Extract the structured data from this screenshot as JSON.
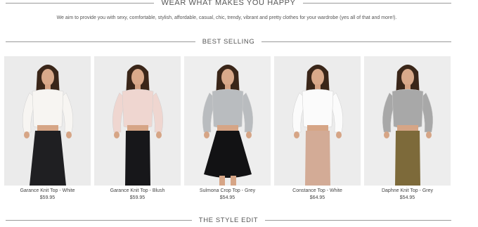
{
  "header": {
    "title": "WEAR WHAT MAKES YOU HAPPY",
    "tagline": "We aim to provide you with sexy, comfortable, stylish, affordable, casual, chic, trendy, vibrant and pretty clothes for your wardrobe (yes all of that and more!)."
  },
  "best_selling": {
    "title": "BEST SELLING",
    "products": [
      {
        "name": "Garance Knit Top - White",
        "price": "$59.95",
        "top_color": "#f7f5f2",
        "bottom_color": "#1f1f22",
        "bottom_style": "ruffle-skirt",
        "bg": "#ebebeb"
      },
      {
        "name": "Garance Knit Top - Blush",
        "price": "$59.95",
        "top_color": "#efd6d0",
        "bottom_color": "#17171a",
        "bottom_style": "pencil-skirt",
        "bg": "#ececec"
      },
      {
        "name": "Sulmona Crop Top - Grey",
        "price": "$54.95",
        "top_color": "#b9bcbf",
        "bottom_color": "#121214",
        "bottom_style": "flare-skirt",
        "bg": "#eeeeee"
      },
      {
        "name": "Constance Top - White",
        "price": "$64.95",
        "top_color": "#fbfbfb",
        "bottom_color": "#d3ab96",
        "bottom_style": "pencil-skirt",
        "bg": "#ececec"
      },
      {
        "name": "Daphne Knit Top - Grey",
        "price": "$54.95",
        "top_color": "#a8a8a8",
        "bottom_color": "#7d6a3a",
        "bottom_style": "pencil-skirt",
        "bg": "#ededed"
      }
    ]
  },
  "style_edit": {
    "title": "THE STYLE EDIT"
  }
}
